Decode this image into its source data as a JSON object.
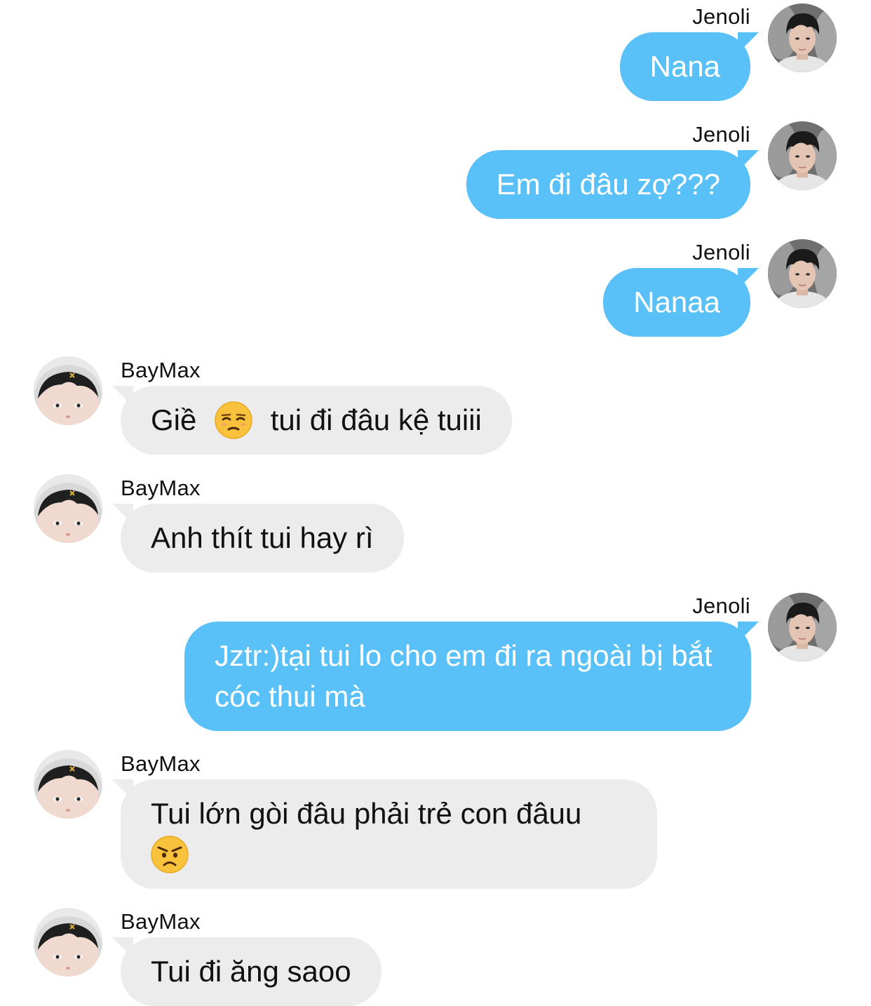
{
  "colors": {
    "outgoing_bubble": "#5ac0f8",
    "incoming_bubble": "#ececec",
    "outgoing_text": "#ffffff",
    "incoming_text": "#111111"
  },
  "messages": [
    {
      "direction": "out",
      "sender": "Jenoli",
      "text": "Nana",
      "avatar_icon": "jenoli-avatar"
    },
    {
      "direction": "out",
      "sender": "Jenoli",
      "text": "Em đi đâu zợ???",
      "avatar_icon": "jenoli-avatar"
    },
    {
      "direction": "out",
      "sender": "Jenoli",
      "text": "Nanaa",
      "avatar_icon": "jenoli-avatar"
    },
    {
      "direction": "in",
      "sender": "BayMax",
      "text_before": "Giề",
      "emoji": "unamused-face-emoji",
      "text_after": "tui đi đâu kệ tuiii",
      "avatar_icon": "baymax-avatar"
    },
    {
      "direction": "in",
      "sender": "BayMax",
      "text": "Anh thít tui hay rì",
      "avatar_icon": "baymax-avatar"
    },
    {
      "direction": "out",
      "sender": "Jenoli",
      "text": "Jztr:)tại tui lo cho em đi ra ngoài bị bắt cóc thui mà",
      "avatar_icon": "jenoli-avatar"
    },
    {
      "direction": "in",
      "sender": "BayMax",
      "text": "Tui lớn gòi đâu phải trẻ con đâuu",
      "emoji": "angry-face-emoji",
      "avatar_icon": "baymax-avatar"
    },
    {
      "direction": "in",
      "sender": "BayMax",
      "text": "Tui đi ăng saoo",
      "avatar_icon": "baymax-avatar"
    }
  ]
}
